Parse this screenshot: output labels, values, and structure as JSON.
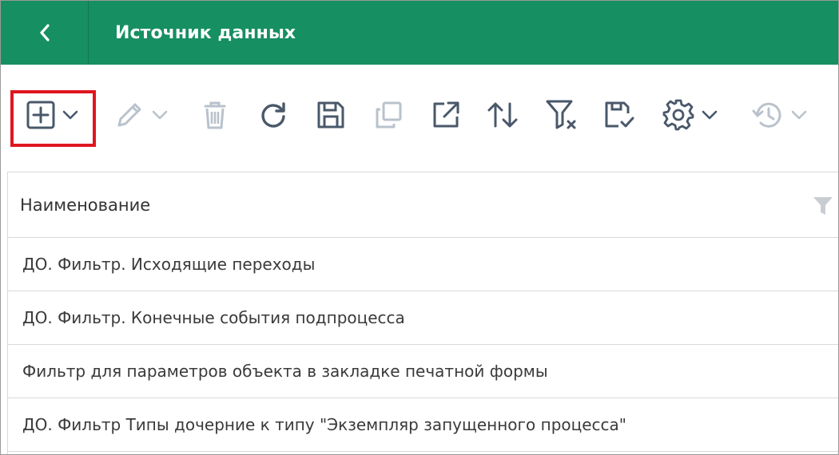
{
  "header": {
    "title": "Источник данных",
    "back_icon": "chevron-left-icon",
    "background": "#168f62"
  },
  "toolbar": {
    "buttons": [
      {
        "name": "add",
        "icon": "plus-square-icon",
        "has_dropdown": true,
        "enabled": true,
        "highlighted": true
      },
      {
        "name": "edit",
        "icon": "pencil-icon",
        "has_dropdown": true,
        "enabled": false
      },
      {
        "name": "delete",
        "icon": "trash-icon",
        "enabled": false
      },
      {
        "name": "refresh",
        "icon": "refresh-icon",
        "enabled": true
      },
      {
        "name": "save",
        "icon": "save-icon",
        "enabled": true
      },
      {
        "name": "copy",
        "icon": "copy-icon",
        "enabled": false
      },
      {
        "name": "open-external",
        "icon": "external-link-icon",
        "enabled": true
      },
      {
        "name": "sort",
        "icon": "sort-icon",
        "enabled": true
      },
      {
        "name": "clear-filter",
        "icon": "filter-clear-icon",
        "enabled": true
      },
      {
        "name": "save-check",
        "icon": "save-check-icon",
        "enabled": true
      },
      {
        "name": "settings",
        "icon": "gear-icon",
        "has_dropdown": true,
        "enabled": true
      },
      {
        "name": "history",
        "icon": "history-icon",
        "has_dropdown": true,
        "enabled": false
      }
    ],
    "highlight_color": "#e0161f"
  },
  "table": {
    "column_header": "Наименование",
    "rows": [
      "ДО. Фильтр. Исходящие переходы",
      "ДО. Фильтр. Конечные события подпроцесса",
      "Фильтр для параметров объекта в закладке печатной формы",
      "ДО. Фильтр Типы дочерние к типу \"Экземпляр запущенного процесса\""
    ]
  }
}
